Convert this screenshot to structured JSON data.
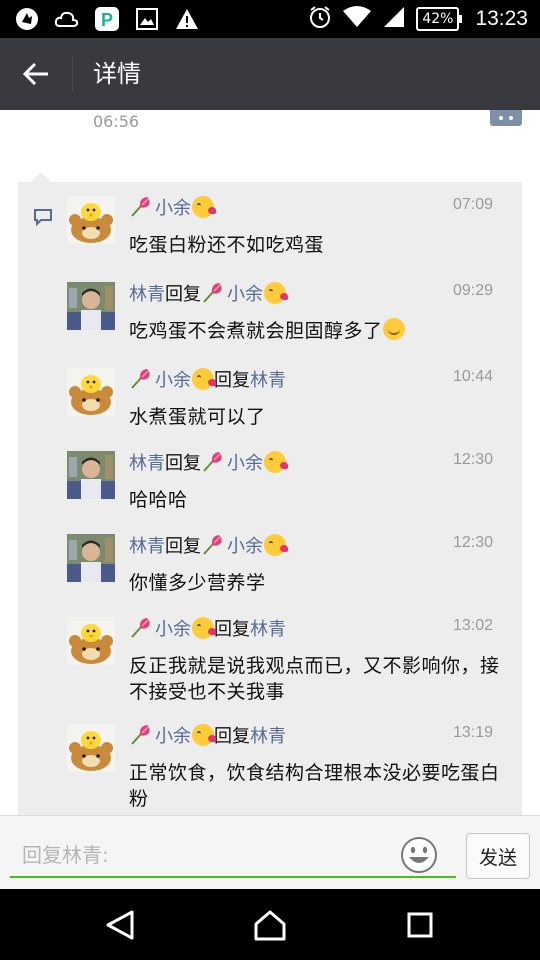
{
  "status_bar": {
    "battery": "42%",
    "time": "13:23",
    "left_icons": [
      "upload-icon",
      "cloud-icon",
      "p-app-icon",
      "image-icon",
      "warning-icon"
    ],
    "right_icons": [
      "alarm-icon",
      "wifi-icon",
      "signal-icon"
    ]
  },
  "header": {
    "title": "详情",
    "back_icon": "arrow-left-icon"
  },
  "post": {
    "time": "06:56"
  },
  "comments": [
    {
      "author": "小余",
      "reply_word": "",
      "reply_to": "",
      "time": "07:09",
      "text": "吃蛋白粉还不如吃鸡蛋",
      "avatar": "bear"
    },
    {
      "author": "林青",
      "reply_word": "回复",
      "reply_to": "小余",
      "time": "09:29",
      "text": "吃鸡蛋不会煮就会胆固醇多了",
      "avatar": "photo"
    },
    {
      "author": "小余",
      "reply_word": "回复",
      "reply_to": "林青",
      "time": "10:44",
      "text": "水煮蛋就可以了",
      "avatar": "bear"
    },
    {
      "author": "林青",
      "reply_word": "回复",
      "reply_to": "小余",
      "time": "12:30",
      "text": "哈哈哈",
      "avatar": "photo"
    },
    {
      "author": "林青",
      "reply_word": "回复",
      "reply_to": "小余",
      "time": "12:30",
      "text": "你懂多少营养学",
      "avatar": "photo"
    },
    {
      "author": "小余",
      "reply_word": "回复",
      "reply_to": "林青",
      "time": "13:02",
      "text": "反正我就是说我观点而已，又不影响你，接不接受也不关我事",
      "avatar": "bear"
    },
    {
      "author": "小余",
      "reply_word": "回复",
      "reply_to": "林青",
      "time": "13:19",
      "text": "正常饮食，饮食结构合理根本没必要吃蛋白粉",
      "avatar": "bear"
    }
  ],
  "input": {
    "placeholder": "回复林青:",
    "send_label": "发送"
  },
  "colors": {
    "title_bar": "#393a3f",
    "name_link": "#576b95",
    "input_underline": "#45c01a",
    "panel_bg": "#ededed"
  }
}
